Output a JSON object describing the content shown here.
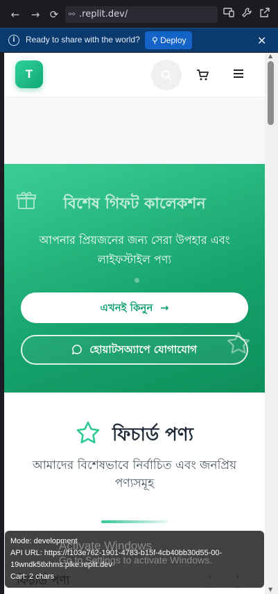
{
  "browser": {
    "url": ".replit.dev/",
    "back_icon": "←",
    "forward_icon": "→",
    "reload_icon": "⟳"
  },
  "banner": {
    "message": "Ready to share with the world?",
    "deploy_label": "Deploy",
    "close_icon": "✕"
  },
  "site": {
    "logo_letter": "T",
    "brand_color": "#16a26c"
  },
  "hero": {
    "title": "বিশেষ গিফট কালেকশন",
    "subtitle": "আপনার প্রিয়জনের জন্য সেরা উপহার এবং লাইফস্টাইল পণ্য",
    "shop_button": "এখনই কিনুন",
    "shop_arrow": "→",
    "whatsapp_button": "হোয়াটসঅ্যাপে যোগাযোগ"
  },
  "featured": {
    "heading": "ফিচার্ড পণ্য",
    "description": "আমাদের বিশেষভাবে নির্বাচিত এবং জনপ্রিয় পণ্যসমূহ",
    "sub_heading": "ফিচার্ড পণ্য",
    "prev_icon": "‹",
    "next_icon": "›"
  },
  "dev_overlay": {
    "mode": "Mode: development",
    "api_url": "API URL: https://f103e762-1901-4783-b15f-4cb40bb30d55-00-19wndk5tlxhms.pike.replit.dev",
    "cart": "Cart: 2 chars"
  },
  "watermark": {
    "line1": "Activate Windows",
    "line2": "Go to Settings to activate Windows."
  }
}
